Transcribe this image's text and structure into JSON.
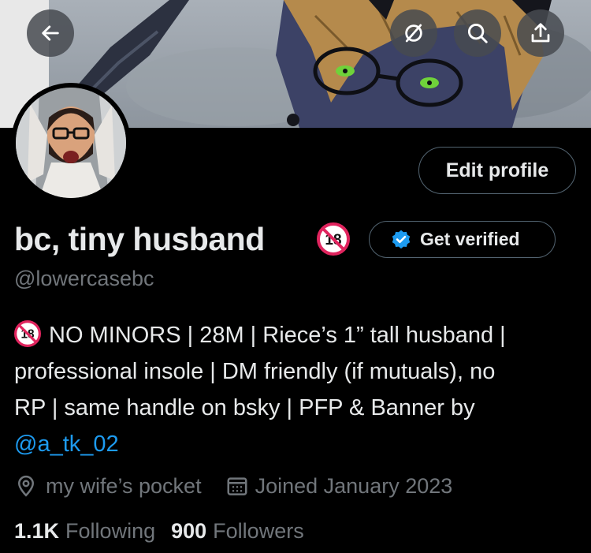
{
  "header": {
    "back_icon": "arrow-left-icon",
    "hide_icon": "slashed-circle-icon",
    "search_icon": "search-icon",
    "share_icon": "share-icon"
  },
  "profile": {
    "edit_label": "Edit profile",
    "name": "bc, tiny husband",
    "name_badge_icon": "no-under-18-icon",
    "verify_label": "Get verified",
    "handle": "@lowercasebc",
    "bio_lines": [
      "NO MINORS | 28M | Riece’s 1” tall husband |",
      "professional insole | DM friendly (if mutuals), no",
      "RP | same handle on bsky | PFP & Banner by"
    ],
    "bio_mention": "@a_tk_02",
    "location": "my wife’s pocket",
    "joined": "Joined January 2023",
    "following_count": "1.1K",
    "following_label": "Following",
    "followers_count": "900",
    "followers_label": "Followers"
  },
  "colors": {
    "background": "#000000",
    "text": "#e7e9ea",
    "muted": "#71767b",
    "link": "#1d9bf0",
    "border": "#536471",
    "adult_badge": "#e0245e"
  }
}
